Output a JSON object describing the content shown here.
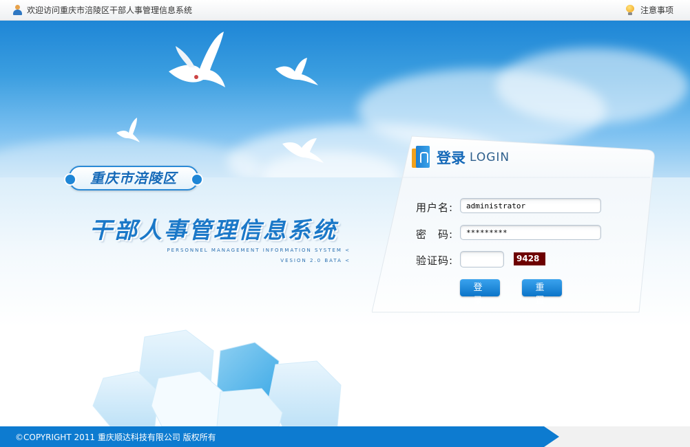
{
  "topbar": {
    "welcome_text": "欢迎访问重庆市涪陵区干部人事管理信息系统",
    "notice_link": "注意事项",
    "user_icon": "user-icon",
    "notice_icon": "lightbulb-icon"
  },
  "banner": {
    "district": "重庆市涪陵区",
    "system_title": "干部人事管理信息系统",
    "subtitle_en": "PERSONNEL MANAGEMENT INFORMATION SYSTEM <",
    "version": "VESION 2.0 BATA <"
  },
  "login": {
    "title_zh": "登录",
    "title_en": "LOGIN",
    "username_label": "用户名:",
    "username_value": "administrator",
    "password_label": "密　码:",
    "password_value": "*********",
    "captcha_label": "验证码:",
    "captcha_value": "",
    "captcha_code": "9428",
    "login_button": "登 录",
    "reset_button": "重 置"
  },
  "footer": {
    "copyright": "©COPYRIGHT 2011 重庆顺达科技有限公司 版权所有"
  },
  "colors": {
    "accent": "#1569b8",
    "footer": "#0d7bd0",
    "captcha_bg": "#6d0000"
  }
}
